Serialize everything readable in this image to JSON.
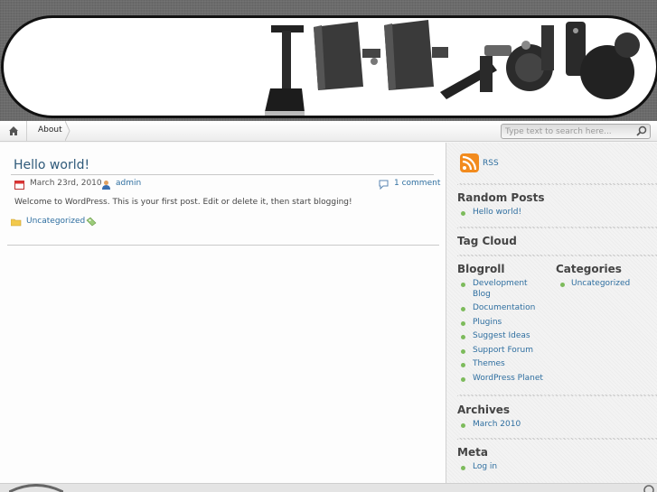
{
  "nav": {
    "about_label": "About"
  },
  "search": {
    "placeholder": "Type text to search here..."
  },
  "post": {
    "title": "Hello world!",
    "date": "March 23rd, 2010",
    "author": "admin",
    "comments": "1 comment",
    "body": "Welcome to WordPress. This is your first post. Edit or delete it, then start blogging!",
    "category": "Uncategorized"
  },
  "sidebar": {
    "rss_label": "RSS",
    "random_posts": {
      "title": "Random Posts",
      "items": [
        "Hello world!"
      ]
    },
    "tag_cloud": {
      "title": "Tag Cloud"
    },
    "blogroll": {
      "title": "Blogroll",
      "items": [
        "Development",
        "Blog",
        "Documentation",
        "Plugins",
        "Suggest Ideas",
        "Support Forum",
        "Themes",
        "WordPress Planet"
      ]
    },
    "categories": {
      "title": "Categories",
      "items": [
        "Uncategorized"
      ]
    },
    "archives": {
      "title": "Archives",
      "items": [
        "March 2010"
      ]
    },
    "meta": {
      "title": "Meta",
      "items": [
        "Log in"
      ]
    }
  },
  "colors": {
    "link": "#2f6fa0",
    "title": "#2f5a7a",
    "bullet": "#7dbb5c",
    "rss": "#f28b1e"
  }
}
